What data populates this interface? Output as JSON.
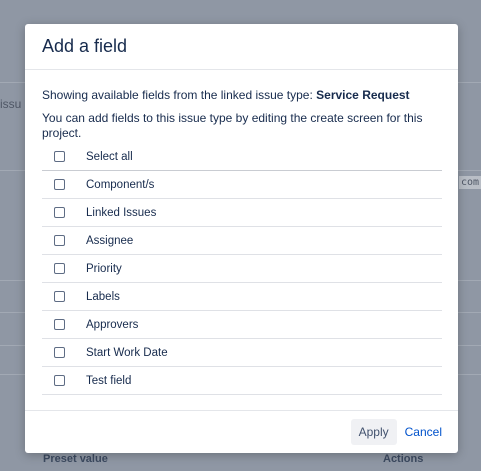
{
  "background": {
    "left_text": "issu",
    "right_text": "com",
    "footer_left": "Preset value",
    "footer_right": "Actions"
  },
  "dialog": {
    "title": "Add a field",
    "info_prefix": "Showing available fields from the linked issue type: ",
    "info_issue_type": "Service Request",
    "hint": "You can add fields to this issue type by editing the create screen for this project.",
    "select_all_label": "Select all",
    "fields": [
      {
        "label": "Component/s",
        "checked": false
      },
      {
        "label": "Linked Issues",
        "checked": false
      },
      {
        "label": "Assignee",
        "checked": false
      },
      {
        "label": "Priority",
        "checked": false
      },
      {
        "label": "Labels",
        "checked": false
      },
      {
        "label": "Approvers",
        "checked": false
      },
      {
        "label": "Start Work Date",
        "checked": false
      },
      {
        "label": "Test field",
        "checked": false
      }
    ],
    "apply_label": "Apply",
    "cancel_label": "Cancel"
  },
  "colors": {
    "overlay": "#8f97a4",
    "link": "#0052cc",
    "text": "#172b4d"
  }
}
